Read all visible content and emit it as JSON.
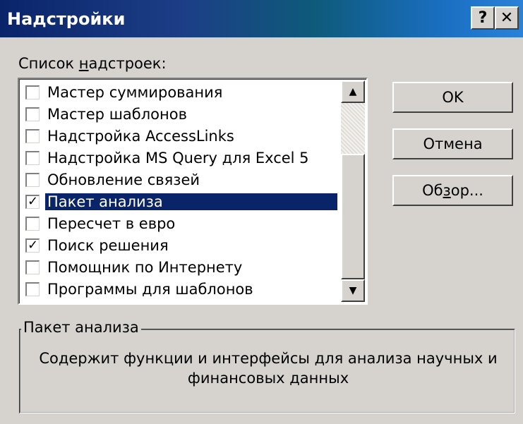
{
  "window": {
    "title": "Надстройки",
    "help_label": "?",
    "close_label": "✕"
  },
  "list": {
    "label_prefix": "Список ",
    "label_accel": "н",
    "label_suffix": "адстроек:",
    "items": [
      {
        "label": "Мастер суммирования",
        "checked": false,
        "check": ""
      },
      {
        "label": "Мастер шаблонов",
        "checked": false,
        "check": ""
      },
      {
        "label": "Надстройка AccessLinks",
        "checked": false,
        "check": ""
      },
      {
        "label": "Надстройка MS Query для Excel 5",
        "checked": false,
        "check": ""
      },
      {
        "label": "Обновление связей",
        "checked": false,
        "check": ""
      },
      {
        "label": "Пакет анализа",
        "checked": true,
        "check": "✓",
        "selected": true
      },
      {
        "label": "Пересчет в евро",
        "checked": false,
        "check": ""
      },
      {
        "label": "Поиск решения",
        "checked": true,
        "check": "✓"
      },
      {
        "label": "Помощник по Интернету",
        "checked": false,
        "check": ""
      },
      {
        "label": "Программы для шаблонов",
        "checked": false,
        "check": ""
      }
    ],
    "scroll_up": "▲",
    "scroll_down": "▼"
  },
  "buttons": {
    "ok": "OK",
    "cancel": "Отмена",
    "browse_prefix": "Об",
    "browse_accel": "з",
    "browse_suffix": "ор..."
  },
  "description": {
    "title": "Пакет анализа",
    "text": "Содержит функции и интерфейсы для анализа научных и финансовых данных"
  }
}
